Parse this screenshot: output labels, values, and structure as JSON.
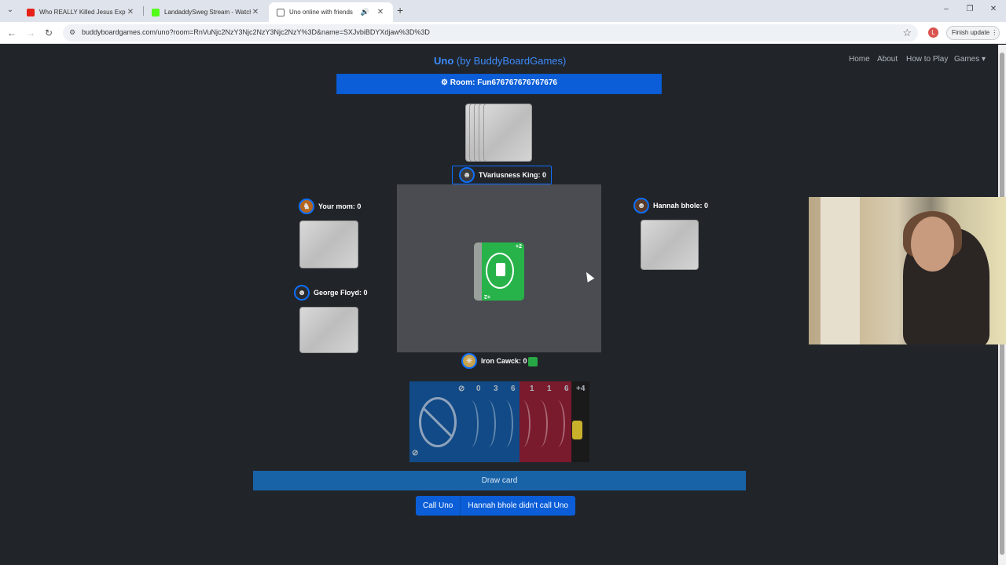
{
  "browser": {
    "tabs": [
      {
        "title": "Who REALLY Killed Jesus Explai",
        "favicon_color": "#e62117",
        "active": false
      },
      {
        "title": "LandaddySweg Stream - Watch",
        "favicon_color": "#53fc18",
        "active": false
      },
      {
        "title": "Uno online with friends",
        "favicon_color": "#555555",
        "active": true
      }
    ],
    "url": "buddyboardgames.com/uno?room=RnVuNjc2NzY3Njc2NzY3Njc2NzY%3D&name=SXJvbiBDYXdjaw%3D%3D",
    "profile_initial": "L",
    "update_label": "Finish update"
  },
  "site": {
    "brand": "Uno",
    "brand_by": " (by BuddyBoardGames)",
    "nav": [
      "Home",
      "About",
      "How to Play",
      "Games"
    ]
  },
  "room": {
    "label": "Room: Fun676767676767676"
  },
  "players": {
    "top": {
      "name": "TVariusness King: 0",
      "icon": "mask-avatar-icon"
    },
    "left_top": {
      "name": "Your mom: 0",
      "icon": "fox-avatar-icon"
    },
    "left_bottom": {
      "name": "George Floyd: 0",
      "icon": "gorilla-avatar-icon"
    },
    "right": {
      "name": "Hannah bhole: 0",
      "icon": "monkey-avatar-icon"
    },
    "me": {
      "name": "Iron Cawck: 0",
      "icon": "lion-avatar-icon"
    }
  },
  "played_card": {
    "color": "#27b34a",
    "label": "+2"
  },
  "hand": {
    "labels": [
      "0",
      "3",
      "6",
      "1",
      "1",
      "6",
      "+4"
    ],
    "colors": {
      "blue": "#114a86",
      "red": "#7a1a2d",
      "black": "#1a1a1a",
      "yellow": "#c9b02a"
    }
  },
  "buttons": {
    "draw": "Draw card",
    "call_uno": "Call Uno",
    "callout": "Hannah bhole didn't call Uno"
  }
}
